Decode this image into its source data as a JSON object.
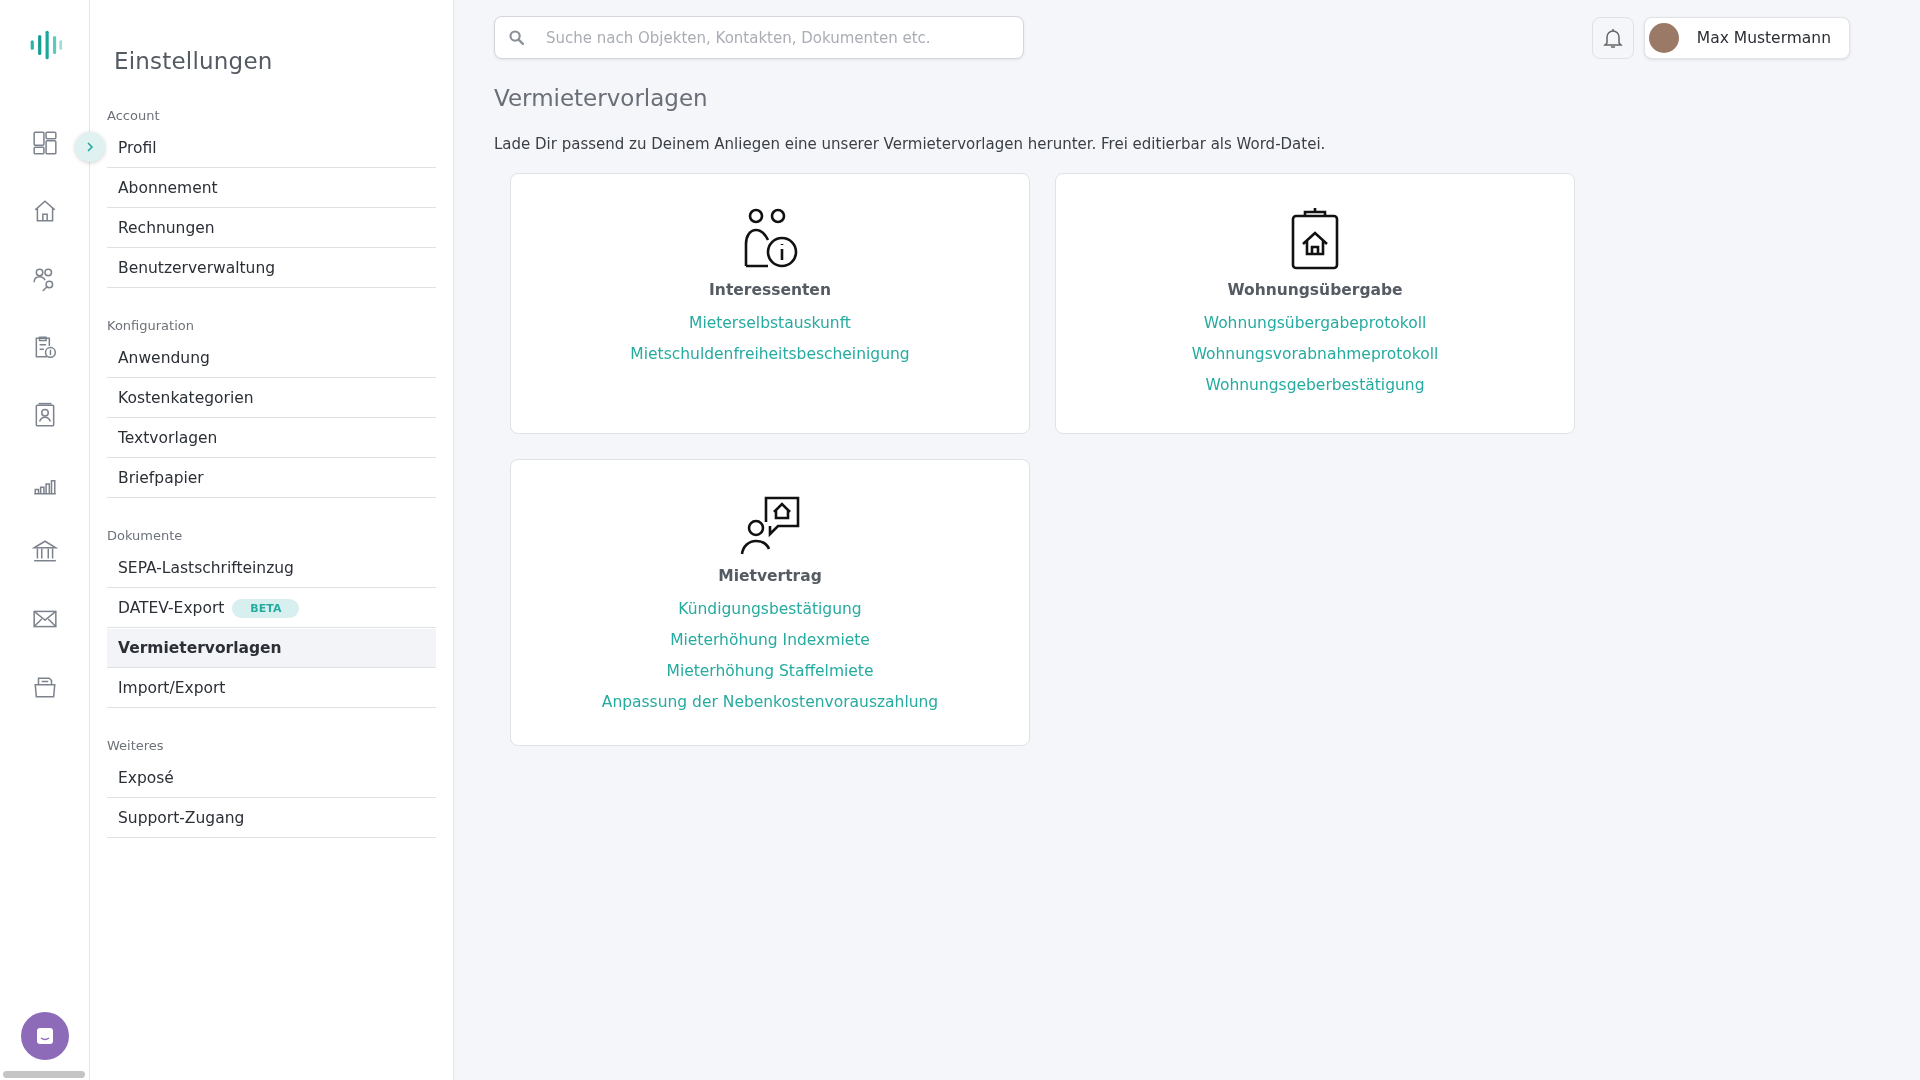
{
  "settings": {
    "title": "Einstellungen",
    "sections": [
      {
        "label": "Account",
        "items": [
          {
            "label": "Profil",
            "selected": false
          },
          {
            "label": "Abonnement",
            "selected": false
          },
          {
            "label": "Rechnungen",
            "selected": false
          },
          {
            "label": "Benutzerverwaltung",
            "selected": false
          }
        ]
      },
      {
        "label": "Konfiguration",
        "items": [
          {
            "label": "Anwendung",
            "selected": false
          },
          {
            "label": "Kostenkategorien",
            "selected": false
          },
          {
            "label": "Textvorlagen",
            "selected": false
          },
          {
            "label": "Briefpapier",
            "selected": false
          }
        ]
      },
      {
        "label": "Dokumente",
        "items": [
          {
            "label": "SEPA-Lastschrifteinzug",
            "selected": false
          },
          {
            "label": "DATEV-Export",
            "badge": "BETA",
            "selected": false
          },
          {
            "label": "Vermietervorlagen",
            "selected": true
          },
          {
            "label": "Import/Export",
            "selected": false
          }
        ]
      },
      {
        "label": "Weiteres",
        "items": [
          {
            "label": "Exposé",
            "selected": false
          },
          {
            "label": "Support-Zugang",
            "selected": false
          }
        ]
      }
    ]
  },
  "search": {
    "placeholder": "Suche nach Objekten, Kontakten, Dokumenten etc."
  },
  "user": {
    "name": "Max Mustermann"
  },
  "page": {
    "title": "Vermietervorlagen",
    "intro": "Lade Dir passend zu Deinem Anliegen eine unserer Vermietervorlagen herunter. Frei editierbar als Word-Datei."
  },
  "cards": [
    {
      "title": "Interessenten",
      "links": [
        "Mieterselbstauskunft",
        "Mietschuldenfreiheitsbescheinigung"
      ]
    },
    {
      "title": "Wohnungsübergabe",
      "links": [
        "Wohnungsübergabeprotokoll",
        "Wohnungsvorabnahmeprotokoll",
        "Wohnungsgeberbestätigung"
      ]
    },
    {
      "title": "Mietvertrag",
      "links": [
        "Kündigungsbestätigung",
        "Mieterhöhung Indexmiete",
        "Mieterhöhung Staffelmiete",
        "Anpassung der Nebenkostenvorauszahlung"
      ]
    }
  ]
}
